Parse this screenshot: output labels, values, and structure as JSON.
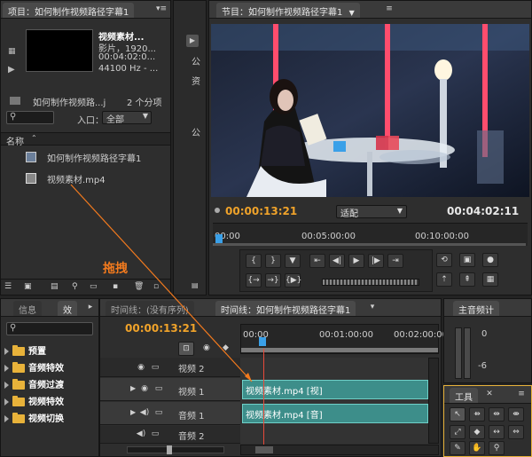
{
  "project": {
    "tab_title": "项目：如何制作视频路径字幕1",
    "clip_name": "视频素材...",
    "clip_type": "影片，1920...",
    "clip_duration": "00:04:02:0...",
    "clip_audio": "44100 Hz - ...",
    "folder_name": "如何制作视频路...j",
    "item_count": "2 个分项",
    "entry_label": "入口：",
    "entry_value": "全部",
    "column_name": "名称",
    "items": [
      "如何制作视频路径字幕1",
      "视频素材.mp4"
    ]
  },
  "side_strip": {
    "labels": [
      "公",
      "资",
      "公"
    ]
  },
  "program": {
    "tab_title": "节目：如何制作视频路径字幕1",
    "current_time": "00:00:13:21",
    "fit_label": "适配",
    "duration": "00:04:02:11",
    "ruler_ticks": [
      "00:00",
      "00:05:00:00",
      "00:10:00:00"
    ]
  },
  "annotation": {
    "drag_label": "拖拽"
  },
  "info": {
    "tab_info": "信息",
    "tab_effects": "效",
    "items": [
      "预置",
      "音频特效",
      "音频过渡",
      "视频特效",
      "视频切换"
    ]
  },
  "timeline": {
    "tab_empty": "时间线：(没有序列)",
    "tab_active": "时间线：如何制作视频路径字幕1",
    "current_time": "00:00:13:21",
    "ruler_ticks": [
      "00:00",
      "00:01:00:00",
      "00:02:00:00"
    ],
    "tracks": [
      {
        "name": "视频 2",
        "clip": ""
      },
      {
        "name": "视频 1",
        "clip": "视频素材.mp4 [视]"
      },
      {
        "name": "音频 1",
        "clip": "视频素材.mp4 [音]"
      },
      {
        "name": "音频 2",
        "clip": ""
      }
    ]
  },
  "audio_master": {
    "tab_title": "主音频计",
    "level_zero": "0",
    "level_minus6": "-6"
  },
  "tools": {
    "tab_title": "工具"
  },
  "colors": {
    "accent_orange": "#f0a32a",
    "clip_teal": "#3d8e8a",
    "playhead_red": "#e84a3a"
  }
}
